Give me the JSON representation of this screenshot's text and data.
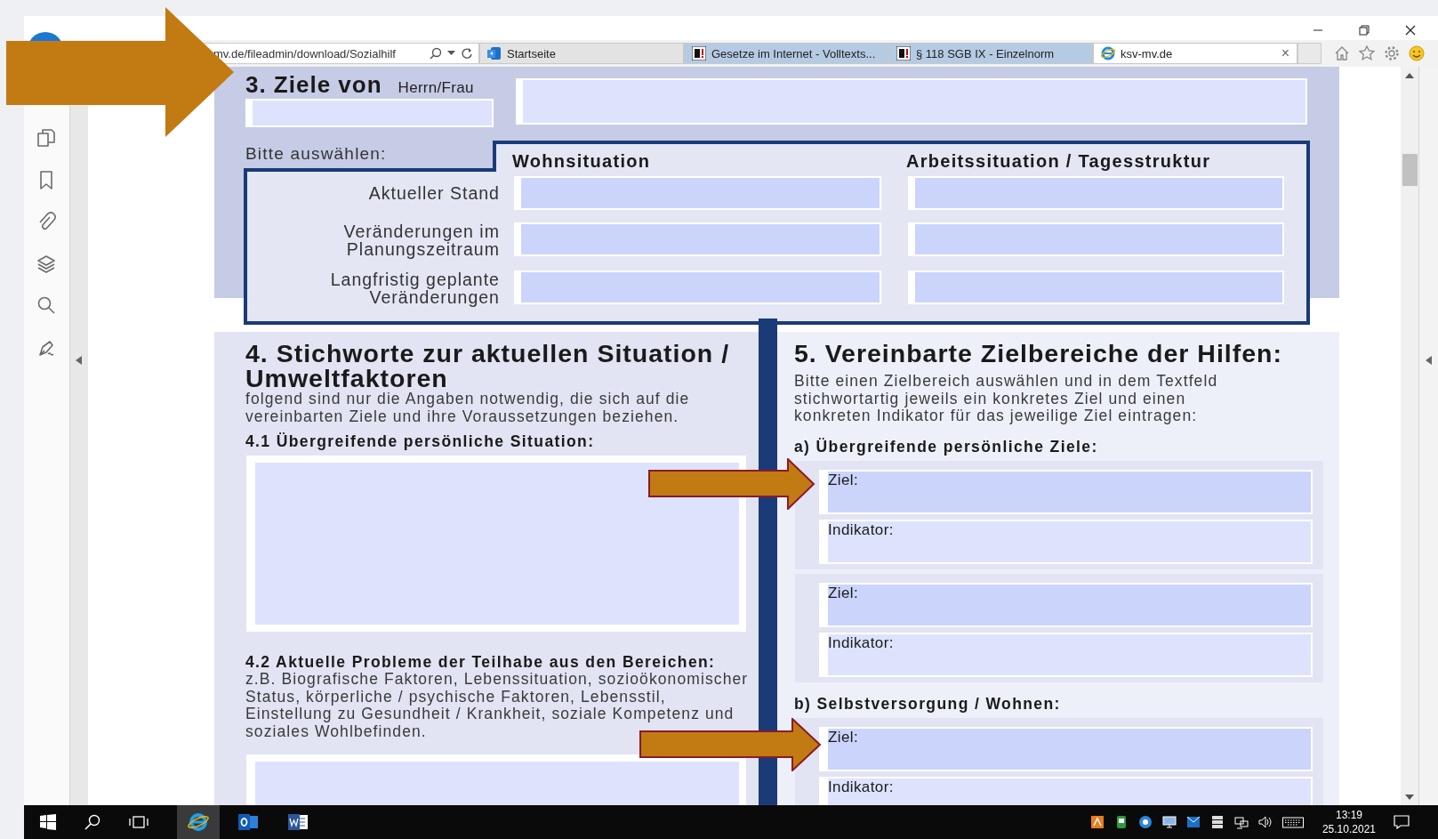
{
  "browser": {
    "address": "mv.de/fileadmin/download/Sozialhilf",
    "tabs": [
      {
        "title": "Startseite",
        "selected": false,
        "color": "#e3e3e3"
      },
      {
        "title": "Gesetze im Internet - Volltexts...",
        "selected": false,
        "color": "#b5cbe4"
      },
      {
        "title": "§ 118 SGB IX - Einzelnorm",
        "selected": false,
        "color": "#b5cbe4"
      },
      {
        "title": "ksv-mv.de",
        "selected": true,
        "close": "×"
      }
    ]
  },
  "section3": {
    "title": "3. Ziele von",
    "salutation": "Herrn/Frau",
    "prompt": "Bitte auswählen:",
    "columns": [
      "Wohnsituation",
      "Arbeitssituation / Tagesstruktur"
    ],
    "rows": [
      "Aktueller Stand",
      "Veränderungen im\nPlanungszeitraum",
      "Langfristig geplante\nVeränderungen"
    ]
  },
  "section4": {
    "title": "4. Stichworte zur aktuellen Situation /\nUmweltfaktoren",
    "intro": "folgend sind nur die Angaben notwendig, die sich auf die\nvereinbarten Ziele und ihre Voraussetzungen beziehen.",
    "subsections": [
      {
        "heading": "4.1 Übergreifende persönliche Situation:"
      },
      {
        "heading": "4.2 Aktuelle Probleme der Teilhabe aus den Bereichen:",
        "text": "z.B. Biografische Faktoren, Lebenssituation, sozioökonomischer\nStatus, körperliche / psychische Faktoren, Lebensstil,\nEinstellung zu Gesundheit / Krankheit, soziale Kompetenz und\nsoziales Wohlbefinden."
      }
    ]
  },
  "section5": {
    "title": "5. Vereinbarte Zielbereiche der Hilfen:",
    "intro": "Bitte einen Zielbereich auswählen und in dem Textfeld\nstichwortartig jeweils ein konkretes Ziel und einen\nkonkreten Indikator für das jeweilige Ziel eintragen:",
    "groups": [
      {
        "heading": "a) Übergreifende persönliche Ziele:",
        "blocks": [
          {
            "fields": [
              {
                "kind": "goal",
                "label": "Ziel:"
              },
              {
                "kind": "indicator",
                "label": "Indikator:"
              }
            ]
          },
          {
            "fields": [
              {
                "kind": "goal",
                "label": "Ziel:"
              },
              {
                "kind": "indicator",
                "label": "Indikator:"
              }
            ]
          }
        ]
      },
      {
        "heading": "b) Selbstversorgung / Wohnen:",
        "blocks": [
          {
            "fields": [
              {
                "kind": "goal",
                "label": "Ziel:"
              },
              {
                "kind": "indicator",
                "label": "Indikator:"
              }
            ]
          }
        ]
      }
    ]
  },
  "taskbar": {
    "apps": [
      {
        "kind": "ie",
        "selected": true
      },
      {
        "kind": "outlook",
        "selected": false
      },
      {
        "kind": "word",
        "selected": false
      }
    ],
    "clock": {
      "time": "13:19",
      "date": "25.10.2021"
    }
  }
}
